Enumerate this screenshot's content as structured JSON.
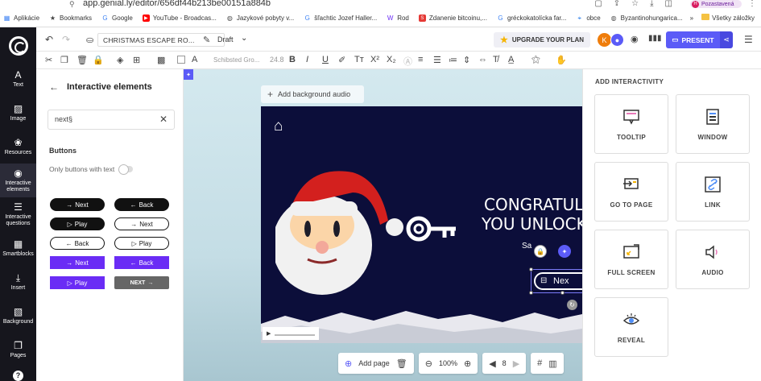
{
  "browser": {
    "url": "app.genial.ly/editor/656df44b213be00151a884b",
    "profile_label": "Pozastavená",
    "profile_initial": "H",
    "bookmarks": [
      {
        "label": "Aplikácie",
        "icon": "apps-grid-icon",
        "color": "#4285f4"
      },
      {
        "label": "Bookmarks",
        "icon": "star-icon",
        "color": "#444444"
      },
      {
        "label": "Google",
        "icon": "google-icon",
        "color": "#4285f4"
      },
      {
        "label": "YouTube - Broadcas...",
        "icon": "youtube-icon",
        "color": "#ff0000"
      },
      {
        "label": "Jazykové pobyty v...",
        "icon": "globe-icon",
        "color": "#555555"
      },
      {
        "label": "šľachtic Jozef Haller...",
        "icon": "google-icon",
        "color": "#4285f4"
      },
      {
        "label": "Rod",
        "icon": "w-icon",
        "color": "#6a2cf5"
      },
      {
        "label": "Zdanenie bitcoinu,...",
        "icon": "s-icon",
        "color": "#e53935"
      },
      {
        "label": "gréckokatolícka far...",
        "icon": "google-icon",
        "color": "#4285f4"
      },
      {
        "label": "obce",
        "icon": "map-icon",
        "color": "#1a73e8"
      },
      {
        "label": "Byzantinohungarica...",
        "icon": "globe-icon",
        "color": "#555555"
      }
    ],
    "bookmarks_more": "»",
    "all_bookmarks": "Všetky záložky"
  },
  "rail": {
    "items": [
      {
        "label": "Text",
        "icon": "A"
      },
      {
        "label": "Image",
        "icon": "▨"
      },
      {
        "label": "Resources",
        "icon": "❀"
      },
      {
        "label": "Interactive elements",
        "icon": "◉"
      },
      {
        "label": "Interactive questions",
        "icon": "☰"
      },
      {
        "label": "Smartblocks",
        "icon": "▦"
      },
      {
        "label": "Insert",
        "icon": "⤓"
      },
      {
        "label": "Background",
        "icon": "▧"
      },
      {
        "label": "Pages",
        "icon": "❐"
      }
    ],
    "help": "?"
  },
  "topbar": {
    "project_title": "CHRISTMAS ESCAPE RO...",
    "status": "Draft",
    "upgrade": "UPGRADE YOUR PLAN",
    "avatar_initial": "K",
    "present": "PRESENT"
  },
  "format": {
    "font": "Schibsted Gro...",
    "size": "24.8"
  },
  "panel": {
    "title": "Interactive elements",
    "search_value": "next§",
    "section": "Buttons",
    "toggle_label": "Only buttons with text",
    "buttons": [
      {
        "label": "Next",
        "arrow": "→",
        "style": "pill-black"
      },
      {
        "label": "Back",
        "arrow": "←",
        "style": "pill-black"
      },
      {
        "label": "Play",
        "arrow": "▷",
        "style": "pill-black"
      },
      {
        "label": "Next",
        "arrow": "→",
        "style": "pill-outline"
      },
      {
        "label": "Back",
        "arrow": "←",
        "style": "pill-outline"
      },
      {
        "label": "Play",
        "arrow": "▷",
        "style": "pill-outline"
      },
      {
        "label": "Next",
        "arrow": "→",
        "style": "rect-purple"
      },
      {
        "label": "Back",
        "arrow": "←",
        "style": "rect-purple"
      },
      {
        "label": "Play",
        "arrow": "▷",
        "style": "rect-purple"
      },
      {
        "label": "NEXT",
        "arrow": "→",
        "style": "rect-gray"
      }
    ]
  },
  "canvas": {
    "bg_audio": "Add background audio",
    "congrats_line1": "CONGRATUL",
    "congrats_line2": "YOU UNLOCK T",
    "small_text": "Sa",
    "next_button": "Nex"
  },
  "bottombar": {
    "add_page": "Add page",
    "zoom": "100%",
    "page": "8"
  },
  "rpanel": {
    "title": "ADD INTERACTIVITY",
    "cards": [
      {
        "label": "TOOLTIP",
        "icon": "tooltip-icon"
      },
      {
        "label": "WINDOW",
        "icon": "window-icon"
      },
      {
        "label": "GO TO PAGE",
        "icon": "go-to-page-icon"
      },
      {
        "label": "LINK",
        "icon": "link-icon"
      },
      {
        "label": "FULL SCREEN",
        "icon": "full-screen-icon"
      },
      {
        "label": "AUDIO",
        "icon": "audio-icon"
      },
      {
        "label": "REVEAL",
        "icon": "reveal-icon"
      }
    ]
  },
  "colors": {
    "accent": "#5b5bf7",
    "purple_button": "#6a2cf5",
    "rail": "#16161d",
    "slide_bg": "#0c0e3a",
    "santa_hat": "#d3201e"
  }
}
